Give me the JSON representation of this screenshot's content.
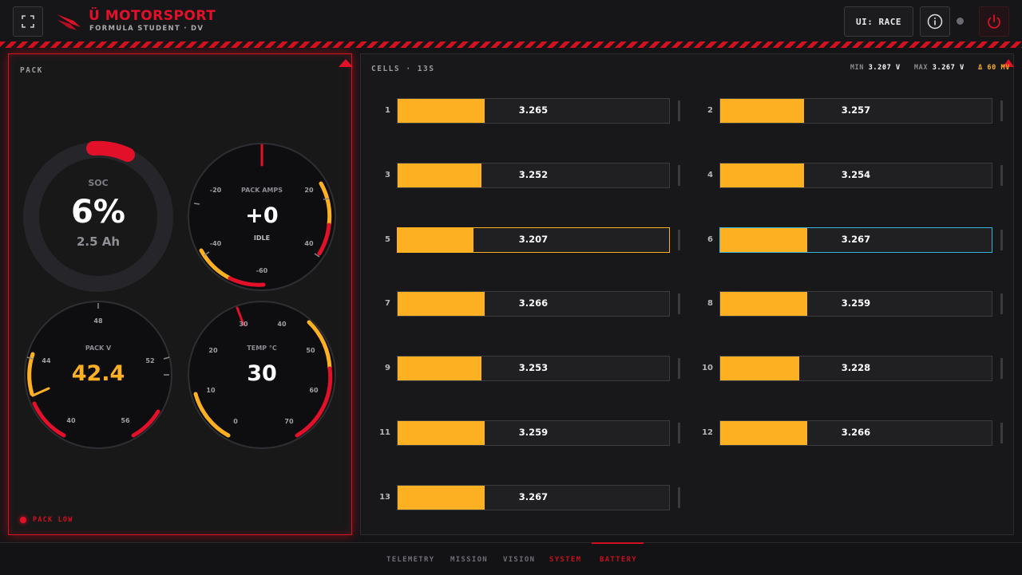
{
  "header": {
    "brand": "Ü MOTORSPORT",
    "subtitle": "FORMULA STUDENT · DV",
    "ui_mode": "UI: RACE",
    "accent": "#e3102a",
    "icons": [
      "fullscreen-icon",
      "logo-icon",
      "info-icon",
      "status-dot-icon",
      "power-icon"
    ]
  },
  "pack": {
    "title": "PACK",
    "soc": {
      "label": "SOC",
      "value": "6%",
      "capacity": "2.5 Ah",
      "fraction": 0.06
    },
    "amps": {
      "label": "PACK AMPS",
      "value": "+0",
      "state": "IDLE",
      "ticks": [
        "-20",
        "20",
        "-40",
        "40",
        "-60"
      ],
      "reading": 0
    },
    "volts": {
      "label": "PACK V",
      "value": "42.4",
      "ticks": [
        "48",
        "44",
        "52",
        "40",
        "56"
      ],
      "reading": 42.4
    },
    "temp": {
      "label": "TEMP °C",
      "value": "30",
      "ticks": [
        "30",
        "40",
        "20",
        "50",
        "10",
        "60",
        "0",
        "70"
      ],
      "reading": 30
    },
    "warning": "PACK LOW"
  },
  "cells": {
    "title": "CELLS · 13S",
    "min_label": "MIN",
    "min_value": "3.207 V",
    "max_label": "MAX",
    "max_value": "3.267 V",
    "delta": "Δ 60 MV",
    "items": [
      {
        "index": "1",
        "voltage": "3.265",
        "level": 0.32
      },
      {
        "index": "2",
        "voltage": "3.257",
        "level": 0.31
      },
      {
        "index": "3",
        "voltage": "3.252",
        "level": 0.31
      },
      {
        "index": "4",
        "voltage": "3.254",
        "level": 0.31
      },
      {
        "index": "5",
        "voltage": "3.207",
        "level": 0.28,
        "highlight": "min"
      },
      {
        "index": "6",
        "voltage": "3.267",
        "level": 0.32,
        "highlight": "max"
      },
      {
        "index": "7",
        "voltage": "3.266",
        "level": 0.32
      },
      {
        "index": "8",
        "voltage": "3.259",
        "level": 0.32
      },
      {
        "index": "9",
        "voltage": "3.253",
        "level": 0.31
      },
      {
        "index": "10",
        "voltage": "3.228",
        "level": 0.29
      },
      {
        "index": "11",
        "voltage": "3.259",
        "level": 0.32
      },
      {
        "index": "12",
        "voltage": "3.266",
        "level": 0.32
      },
      {
        "index": "13",
        "voltage": "3.267",
        "level": 0.32
      }
    ]
  },
  "nav": {
    "tabs": [
      {
        "label": "TELEMETRY"
      },
      {
        "label": "MISSION"
      },
      {
        "label": "VISION"
      },
      {
        "label": "SYSTEM"
      },
      {
        "label": "BATTERY",
        "active": true
      }
    ]
  },
  "colors": {
    "amber": "#fdb022",
    "red": "#e3102a",
    "cyan": "#35b6d8"
  }
}
